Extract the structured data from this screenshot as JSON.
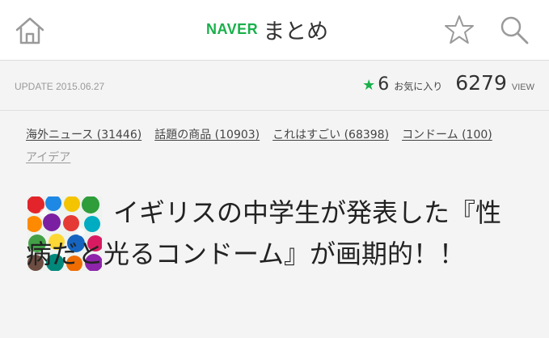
{
  "header": {
    "brand": "NAVER",
    "service": "まとめ",
    "icons": {
      "home": "home-icon",
      "favorite": "star-outline-icon",
      "search": "search-icon"
    }
  },
  "meta": {
    "update": "UPDATE 2015.06.27",
    "favorites_count": "6",
    "favorites_label": "お気に入り",
    "views_count": "6279",
    "views_label": "VIEW"
  },
  "tags": [
    {
      "label": "海外ニュース (31446)"
    },
    {
      "label": "話題の商品 (10903)"
    },
    {
      "label": "これはすごい (68398)"
    },
    {
      "label": "コンドーム (100)"
    },
    {
      "label": "アイデア"
    }
  ],
  "article": {
    "title": "イギリスの中学生が発表した『性病だと光るコンドーム』が画期的！！"
  },
  "colors": {
    "accent": "#19b04b",
    "background": "#f4f4f4",
    "header": "#ffffff"
  }
}
